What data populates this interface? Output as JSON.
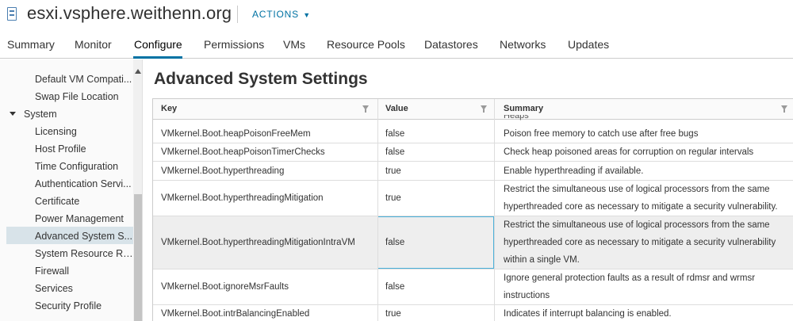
{
  "header": {
    "host_name": "esxi.vsphere.weithenn.org",
    "actions_label": "ACTIONS"
  },
  "tabs": [
    {
      "label": "Summary"
    },
    {
      "label": "Monitor"
    },
    {
      "label": "Configure",
      "active": true
    },
    {
      "label": "Permissions"
    },
    {
      "label": "VMs"
    },
    {
      "label": "Resource Pools"
    },
    {
      "label": "Datastores"
    },
    {
      "label": "Networks"
    },
    {
      "label": "Updates"
    }
  ],
  "sidebar": {
    "items": [
      {
        "label": "Default VM Compati..."
      },
      {
        "label": "Swap File Location"
      },
      {
        "label": "System",
        "group": true
      },
      {
        "label": "Licensing"
      },
      {
        "label": "Host Profile"
      },
      {
        "label": "Time Configuration"
      },
      {
        "label": "Authentication Servi..."
      },
      {
        "label": "Certificate"
      },
      {
        "label": "Power Management"
      },
      {
        "label": "Advanced System S...",
        "selected": true
      },
      {
        "label": "System Resource Re..."
      },
      {
        "label": "Firewall"
      },
      {
        "label": "Services"
      },
      {
        "label": "Security Profile"
      }
    ]
  },
  "main": {
    "title": "Advanced System Settings",
    "columns": {
      "key": "Key",
      "value": "Value",
      "summary": "Summary"
    },
    "clipped_summary": "Heaps",
    "rows": [
      {
        "key": "VMkernel.Boot.heapPoisonFreeMem",
        "value": "false",
        "summary": "Poison free memory to catch use after free bugs"
      },
      {
        "key": "VMkernel.Boot.heapPoisonTimerChecks",
        "value": "false",
        "summary": "Check heap poisoned areas for corruption on regular intervals"
      },
      {
        "key": "VMkernel.Boot.hyperthreading",
        "value": "true",
        "summary": "Enable hyperthreading if available."
      },
      {
        "key": "VMkernel.Boot.hyperthreadingMitigation",
        "value": "true",
        "summary": "Restrict the simultaneous use of logical processors from the same hyperthreaded core as necessary to mitigate a security vulnerability."
      },
      {
        "key": "VMkernel.Boot.hyperthreadingMitigationIntraVM",
        "value": "false",
        "summary": "Restrict the simultaneous use of logical processors from the same hyperthreaded core as necessary to mitigate a security vulnerability within a single VM.",
        "selected": true
      },
      {
        "key": "VMkernel.Boot.ignoreMsrFaults",
        "value": "false",
        "summary": "Ignore general protection faults as a result of rdmsr and wrmsr instructions"
      },
      {
        "key": "VMkernel.Boot.intrBalancingEnabled",
        "value": "true",
        "summary": "Indicates if interrupt balancing is enabled."
      }
    ]
  },
  "colors": {
    "accent": "#0072a3",
    "selected_row": "#eeeeee",
    "focus_border": "#49afd9",
    "nav_selected": "#d8e3e9"
  }
}
